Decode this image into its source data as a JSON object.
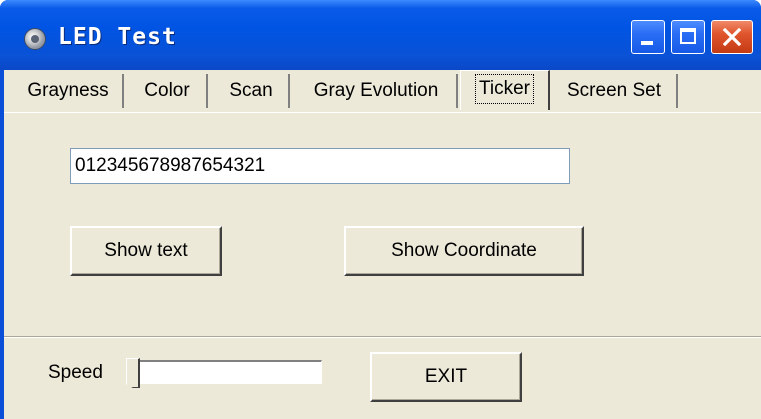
{
  "window": {
    "title": "LED Test",
    "app_icon": "disc-icon",
    "controls": [
      "minimize-icon",
      "maximize-icon",
      "close-icon"
    ]
  },
  "tabs": [
    {
      "label": "Grayness",
      "active": false
    },
    {
      "label": "Color",
      "active": false
    },
    {
      "label": "Scan",
      "active": false
    },
    {
      "label": "Gray Evolution",
      "active": false
    },
    {
      "label": "Ticker",
      "active": true
    },
    {
      "label": "Screen Set",
      "active": false
    }
  ],
  "ticker": {
    "text_value": "012345678987654321",
    "show_text_label": "Show text",
    "show_coordinate_label": "Show Coordinate"
  },
  "footer": {
    "speed_label": "Speed",
    "speed_value": 0,
    "exit_label": "EXIT"
  },
  "colors": {
    "titlebar": "#0054e3",
    "client_bg": "#ece9d8",
    "close_button": "#e0552c"
  }
}
